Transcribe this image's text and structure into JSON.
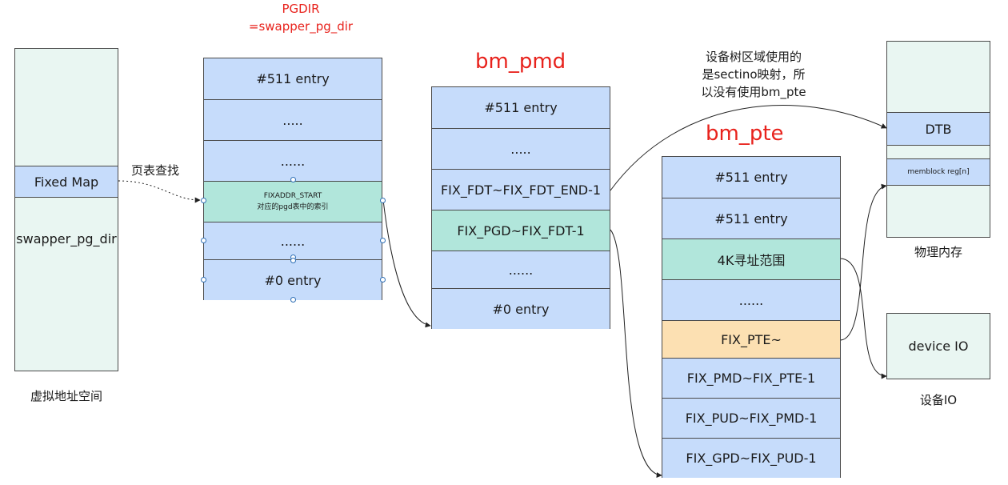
{
  "virtual": {
    "fixed_map": "Fixed Map",
    "swapper": "swapper_pg_dir",
    "caption": "虚拟地址空间"
  },
  "pgdir": {
    "title_line1": "PGDIR",
    "title_line2": "=swapper_pg_dir",
    "cells": [
      "#511 entry",
      ".....",
      "......",
      "FIXADDR_START",
      "......",
      "#0 entry"
    ],
    "fix_sub": "对应的pgd表中的索引"
  },
  "lookup_label": "页表查找",
  "bm_pmd": {
    "title": "bm_pmd",
    "cells": [
      "#511 entry",
      ".....",
      "FIX_FDT~FIX_FDT_END-1",
      "FIX_PGD~FIX_FDT-1",
      "......",
      "#0 entry"
    ]
  },
  "note": {
    "line1": "设备树区域使用的",
    "line2": "是sectino映射，所",
    "line3": "以没有使用bm_pte"
  },
  "bm_pte": {
    "title": "bm_pte",
    "cells": [
      "#511 entry",
      "#511 entry",
      "4K寻址范围",
      "......",
      "FIX_PTE~",
      "FIX_PMD~FIX_PTE-1",
      "FIX_PUD~FIX_PMD-1",
      "FIX_GPD~FIX_PUD-1"
    ]
  },
  "physical": {
    "dtb": "DTB",
    "memblock": "memblock reg[n]",
    "caption": "物理内存"
  },
  "device": {
    "box": "device IO",
    "caption": "设备IO"
  },
  "colors": {
    "blue": "#c6dcfb",
    "mint": "#e9f6f2",
    "teal": "#b1e6db",
    "peach": "#fce0b2",
    "title_red": "#e8221c"
  }
}
